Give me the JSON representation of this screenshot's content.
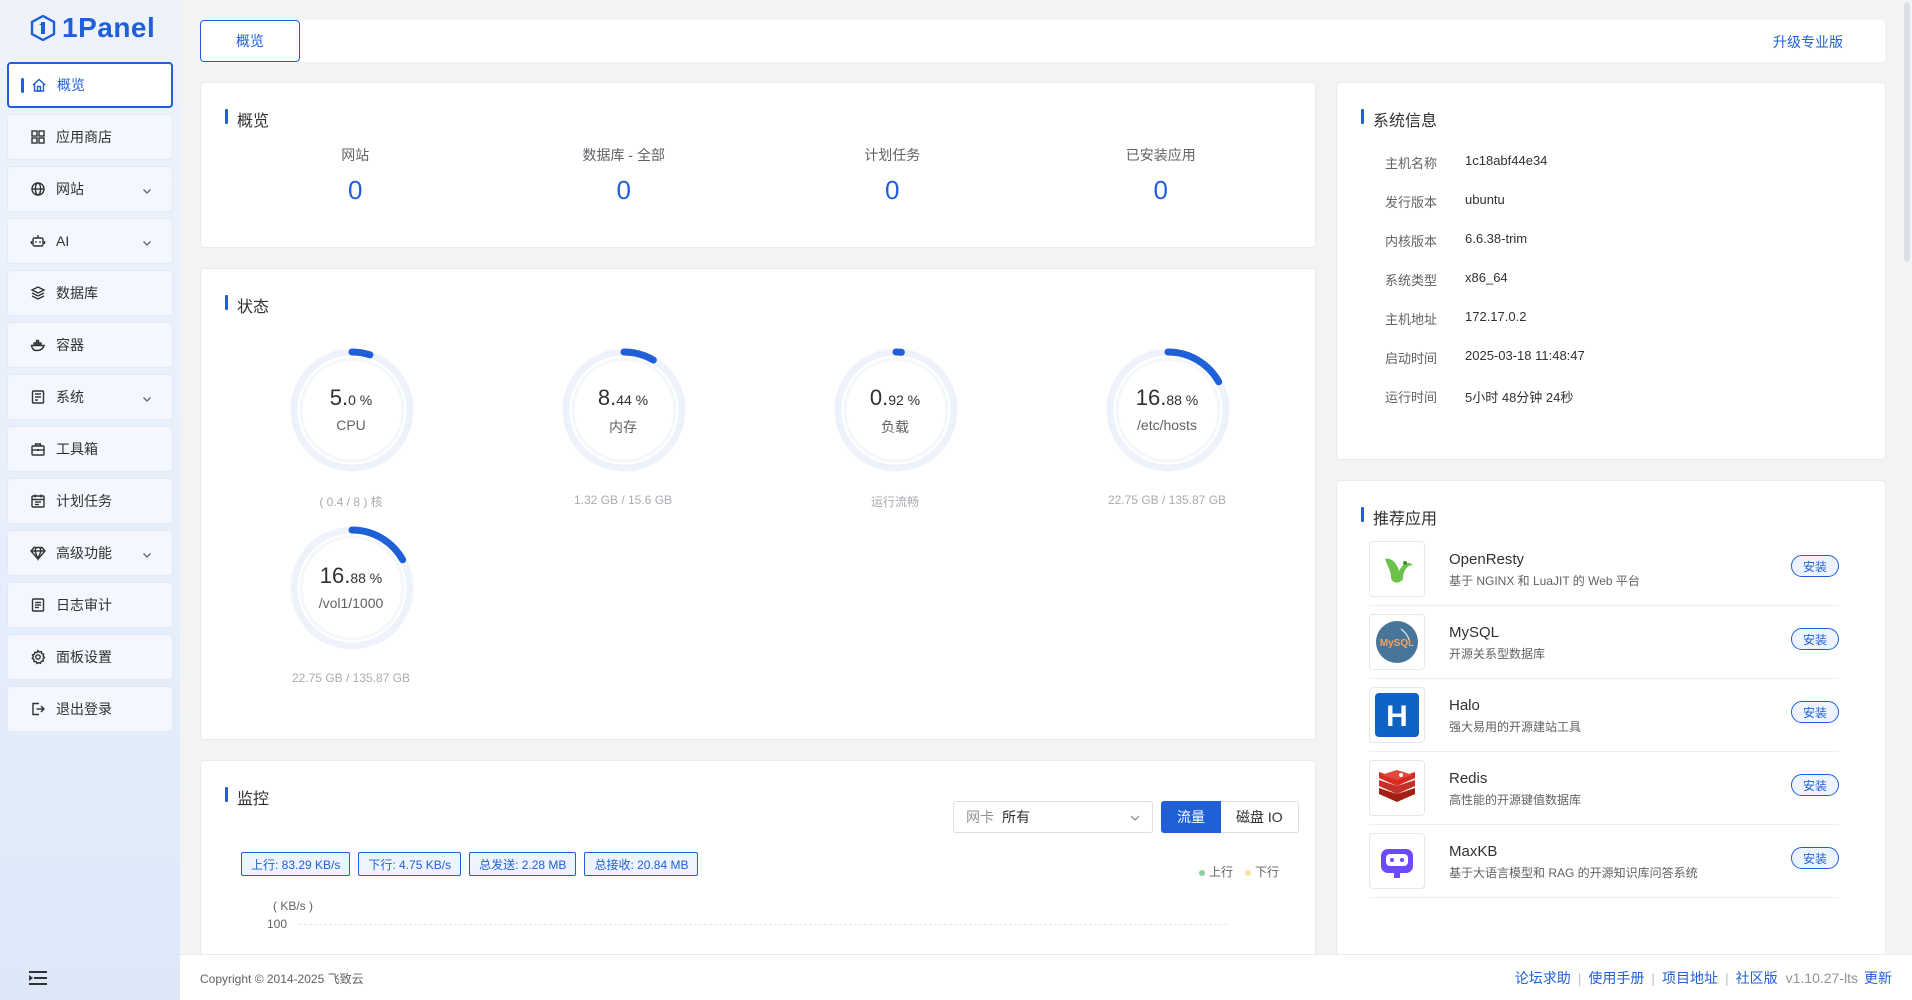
{
  "app": {
    "logo_text": "1Panel"
  },
  "sidebar": {
    "items": [
      {
        "label": "概览",
        "icon": "home-icon",
        "active": true
      },
      {
        "label": "应用商店",
        "icon": "grid-icon"
      },
      {
        "label": "网站",
        "icon": "globe-icon",
        "expand": true
      },
      {
        "label": "AI",
        "icon": "robot-icon",
        "expand": true
      },
      {
        "label": "数据库",
        "icon": "layers-icon"
      },
      {
        "label": "容器",
        "icon": "docker-icon"
      },
      {
        "label": "系统",
        "icon": "server-icon",
        "expand": true
      },
      {
        "label": "工具箱",
        "icon": "toolbox-icon"
      },
      {
        "label": "计划任务",
        "icon": "calendar-icon"
      },
      {
        "label": "高级功能",
        "icon": "diamond-icon",
        "expand": true
      },
      {
        "label": "日志审计",
        "icon": "log-icon"
      },
      {
        "label": "面板设置",
        "icon": "gear-icon"
      },
      {
        "label": "退出登录",
        "icon": "logout-icon"
      }
    ]
  },
  "topbar": {
    "tab": "概览",
    "upgrade": "升级专业版"
  },
  "overview": {
    "title": "概览",
    "stats": [
      {
        "label": "网站",
        "value": "0"
      },
      {
        "label": "数据库 - 全部",
        "value": "0"
      },
      {
        "label": "计划任务",
        "value": "0"
      },
      {
        "label": "已安装应用",
        "value": "0"
      }
    ]
  },
  "status": {
    "title": "状态",
    "gauges": [
      {
        "int": "5.",
        "dec": "0 %",
        "name": "CPU",
        "sub": "( 0.4 / 8 ) 核",
        "percent": 5.0
      },
      {
        "int": "8.",
        "dec": "44 %",
        "name": "内存",
        "sub": "1.32 GB / 15.6 GB",
        "percent": 8.44
      },
      {
        "int": "0.",
        "dec": "92 %",
        "name": "负载",
        "sub": "运行流畅",
        "percent": 0.92
      },
      {
        "int": "16.",
        "dec": "88 %",
        "name": "/etc/hosts",
        "sub": "22.75 GB / 135.87 GB",
        "percent": 16.88
      },
      {
        "int": "16.",
        "dec": "88 %",
        "name": "/vol1/1000",
        "sub": "22.75 GB / 135.87 GB",
        "percent": 16.88
      }
    ]
  },
  "monitor": {
    "title": "监控",
    "nic_label": "网卡",
    "nic_value": "所有",
    "btn_traffic": "流量",
    "btn_disk": "磁盘 IO",
    "tags": {
      "up": "上行: 83.29 KB/s",
      "down": "下行: 4.75 KB/s",
      "sent": "总发送: 2.28 MB",
      "recv": "总接收: 20.84 MB"
    },
    "legend_up": "上行",
    "legend_down": "下行",
    "unit": "( KB/s )",
    "y_tick": "100"
  },
  "sysinfo": {
    "title": "系统信息",
    "rows": [
      {
        "key": "主机名称",
        "value": "1c18abf44e34"
      },
      {
        "key": "发行版本",
        "value": "ubuntu"
      },
      {
        "key": "内核版本",
        "value": "6.6.38-trim"
      },
      {
        "key": "系统类型",
        "value": "x86_64"
      },
      {
        "key": "主机地址",
        "value": "172.17.0.2"
      },
      {
        "key": "启动时间",
        "value": "2025-03-18 11:48:47"
      },
      {
        "key": "运行时间",
        "value": "5小时 48分钟 24秒"
      }
    ]
  },
  "apps": {
    "title": "推荐应用",
    "install_label": "安装",
    "items": [
      {
        "name": "OpenResty",
        "desc": "基于 NGINX 和 LuaJIT 的 Web 平台",
        "logo": "openresty-logo"
      },
      {
        "name": "MySQL",
        "desc": "开源关系型数据库",
        "logo": "mysql-logo",
        "logo_text": "MySQL"
      },
      {
        "name": "Halo",
        "desc": "强大易用的开源建站工具",
        "logo": "halo-logo",
        "logo_text": "H"
      },
      {
        "name": "Redis",
        "desc": "高性能的开源键值数据库",
        "logo": "redis-logo"
      },
      {
        "name": "MaxKB",
        "desc": "基于大语言模型和 RAG 的开源知识库问答系统",
        "logo": "maxkb-logo"
      }
    ]
  },
  "footer": {
    "copyright": "Copyright © 2014-2025 飞致云",
    "links": [
      "论坛求助",
      "使用手册",
      "项目地址",
      "社区版"
    ],
    "version": "v1.10.27-lts",
    "update": "更新"
  },
  "colors": {
    "primary": "#1f5fd8",
    "gauge_track": "#eef3fb",
    "legend_up": "#8fd19e",
    "legend_down": "#fbe3a6"
  }
}
